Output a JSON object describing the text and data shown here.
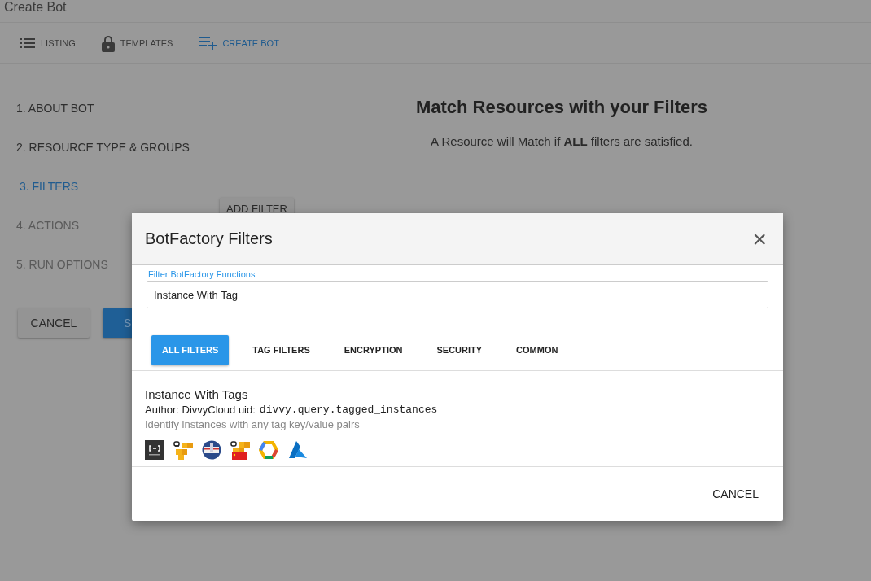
{
  "page_title": "Create Bot",
  "nav": [
    {
      "label": "LISTING",
      "selected": false
    },
    {
      "label": "TEMPLATES",
      "selected": false
    },
    {
      "label": "CREATE BOT",
      "selected": true
    }
  ],
  "steps": [
    {
      "label": "1. ABOUT BOT",
      "selected": false,
      "disabled": false
    },
    {
      "label": "2. RESOURCE TYPE & GROUPS",
      "selected": false,
      "disabled": false
    },
    {
      "label": "3. FILTERS",
      "selected": true,
      "disabled": false
    },
    {
      "label": "4. ACTIONS",
      "selected": false,
      "disabled": true
    },
    {
      "label": "5. RUN OPTIONS",
      "selected": false,
      "disabled": true
    }
  ],
  "form_buttons": {
    "cancel": "CANCEL",
    "save": "S"
  },
  "heading": "Match Resources with your Filters",
  "subheading": "A Resource will Match if **ALL** filters are satisfied.",
  "add_filter_button": "ADD FILTER",
  "modal": {
    "title": "BotFactory Filters",
    "close": "×",
    "search": {
      "label": "Filter BotFactory Functions",
      "value": "Instance With Tag"
    },
    "tabs": [
      {
        "label": "ALL FILTERS",
        "selected": true
      },
      {
        "label": "TAG FILTERS",
        "selected": false
      },
      {
        "label": "ENCRYPTION",
        "selected": false
      },
      {
        "label": "SECURITY",
        "selected": false
      },
      {
        "label": "COMMON",
        "selected": false
      }
    ],
    "results": [
      {
        "title": "Instance With Tags",
        "author": "Author: DivvyCloud uid:",
        "uid": "divvy.query.tagged_instances",
        "description": "Identify instances with any tag key/value pairs"
      }
    ],
    "footer_button": "CANCEL"
  }
}
